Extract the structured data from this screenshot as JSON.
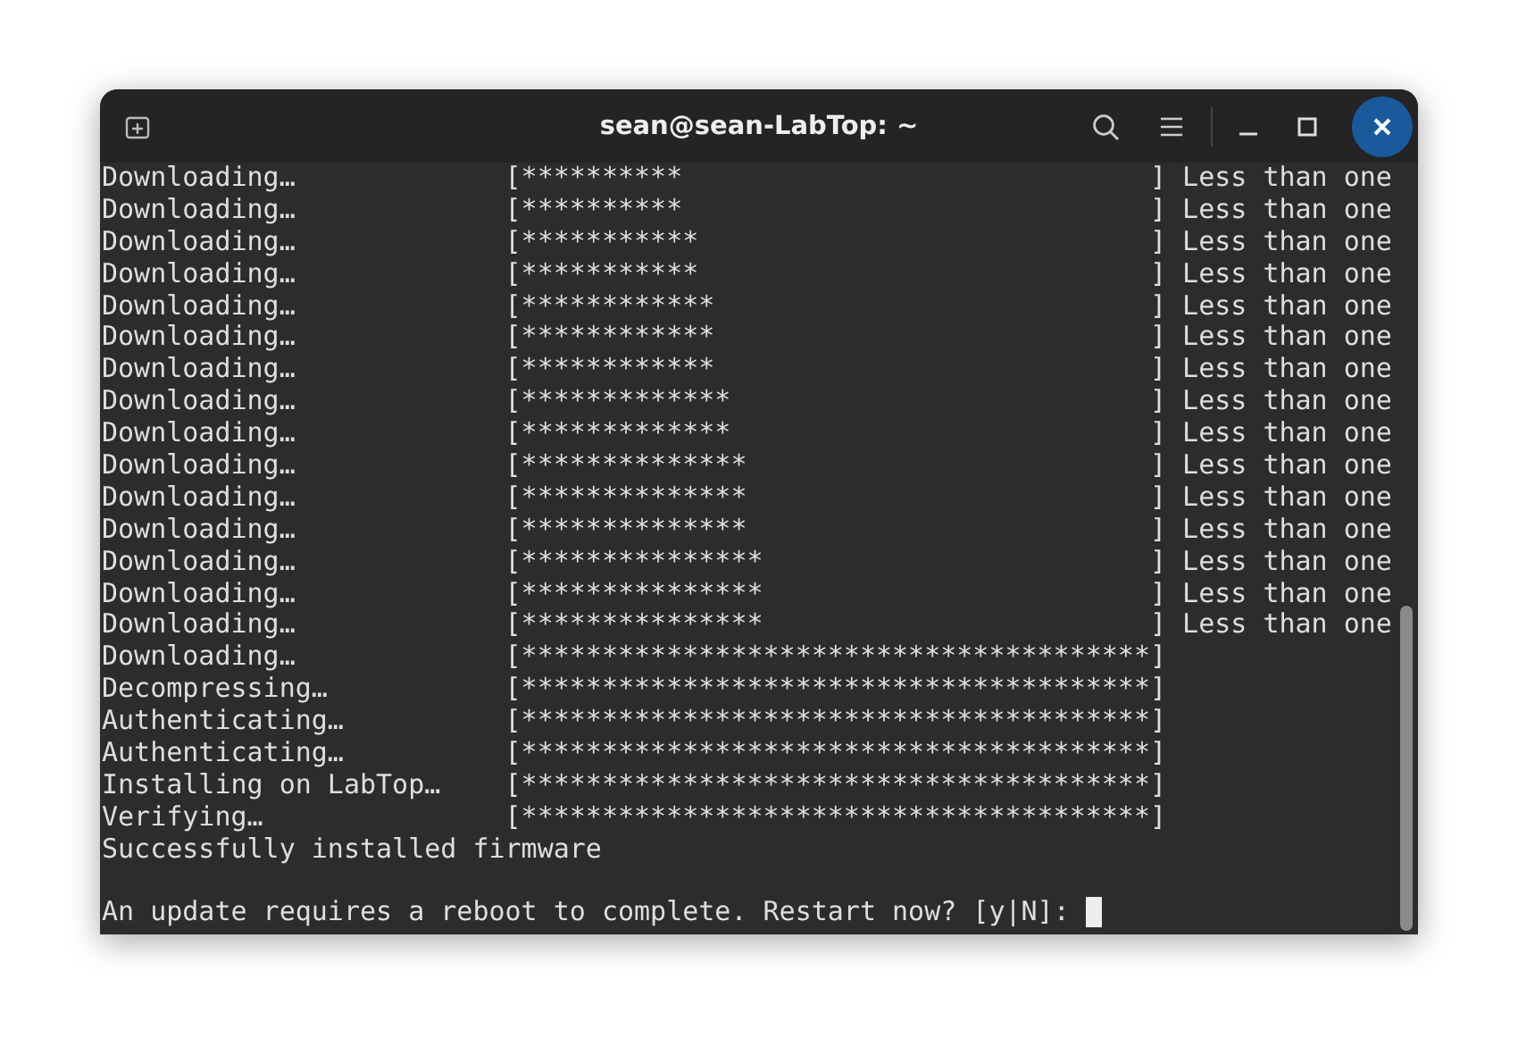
{
  "window": {
    "title": "sean@sean-LabTop: ~"
  },
  "terminal": {
    "lines": [
      {
        "label": "Downloading…",
        "bar": "[**********                             ]",
        "eta": "Less than one"
      },
      {
        "label": "Downloading…",
        "bar": "[**********                             ]",
        "eta": "Less than one"
      },
      {
        "label": "Downloading…",
        "bar": "[***********                            ]",
        "eta": "Less than one"
      },
      {
        "label": "Downloading…",
        "bar": "[***********                            ]",
        "eta": "Less than one"
      },
      {
        "label": "Downloading…",
        "bar": "[************                           ]",
        "eta": "Less than one"
      },
      {
        "label": "Downloading…",
        "bar": "[************                           ]",
        "eta": "Less than one"
      },
      {
        "label": "Downloading…",
        "bar": "[************                           ]",
        "eta": "Less than one"
      },
      {
        "label": "Downloading…",
        "bar": "[*************                          ]",
        "eta": "Less than one"
      },
      {
        "label": "Downloading…",
        "bar": "[*************                          ]",
        "eta": "Less than one"
      },
      {
        "label": "Downloading…",
        "bar": "[**************                         ]",
        "eta": "Less than one"
      },
      {
        "label": "Downloading…",
        "bar": "[**************                         ]",
        "eta": "Less than one"
      },
      {
        "label": "Downloading…",
        "bar": "[**************                         ]",
        "eta": "Less than one"
      },
      {
        "label": "Downloading…",
        "bar": "[***************                        ]",
        "eta": "Less than one"
      },
      {
        "label": "Downloading…",
        "bar": "[***************                        ]",
        "eta": "Less than one"
      },
      {
        "label": "Downloading…",
        "bar": "[***************                        ]",
        "eta": "Less than one"
      },
      {
        "label": "Downloading…",
        "bar": "[***************************************]"
      },
      {
        "label": "Decompressing…",
        "bar": "[***************************************]"
      },
      {
        "label": "Authenticating…",
        "bar": "[***************************************]"
      },
      {
        "label": "Authenticating…",
        "bar": "[***************************************]"
      },
      {
        "label": "Installing on LabTop…",
        "bar": "[***************************************]"
      },
      {
        "label": "Verifying…",
        "bar": "[***************************************]"
      },
      {
        "text": "Successfully installed firmware"
      }
    ],
    "prompt": "An update requires a reboot to complete. Restart now? [y|N]:"
  }
}
